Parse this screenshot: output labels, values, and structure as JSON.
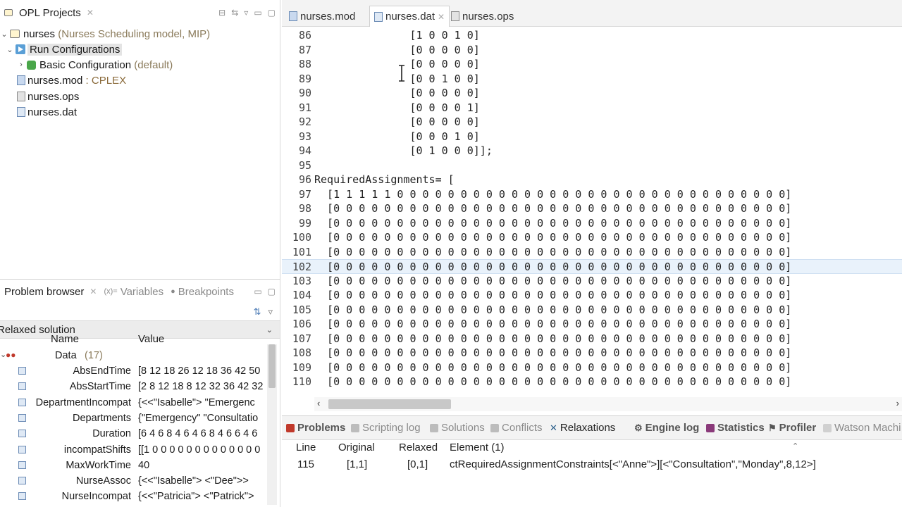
{
  "explorer": {
    "title": "OPL Projects",
    "tree": {
      "project_name": "nurses",
      "project_desc": "(Nurses Scheduling model, MIP)",
      "run_configs": "Run Configurations",
      "basic_config": "Basic Configuration",
      "basic_config_suffix": "(default)",
      "mod_file": "nurses.mod",
      "mod_suffix": ": CPLEX",
      "ops_file": "nurses.ops",
      "dat_file": "nurses.dat"
    }
  },
  "problem_view": {
    "tabs": [
      "Problem browser",
      "Variables",
      "Breakpoints"
    ],
    "section": "Relaxed solution",
    "col_name": "Name",
    "col_value": "Value",
    "group_label": "Data",
    "group_count": "(17)",
    "rows": [
      {
        "name": "AbsEndTime",
        "value": "[8 12 18 26 12 18 36 42 50"
      },
      {
        "name": "AbsStartTime",
        "value": "[2 8 12 18 8 12 32 36 42 32"
      },
      {
        "name": "DepartmentIncompat",
        "value": "{<<\"Isabelle\"> \"Emergenc"
      },
      {
        "name": "Departments",
        "value": "{\"Emergency\" \"Consultatio"
      },
      {
        "name": "Duration",
        "value": "[6 4 6 8 4 6 4 6 8 4 6 6 4 6"
      },
      {
        "name": "incompatShifts",
        "value": "[[1 0 0 0 0 0 0 0 0 0 0 0 0 0"
      },
      {
        "name": "MaxWorkTime",
        "value": "40"
      },
      {
        "name": "NurseAssoc",
        "value": "{<<\"Isabelle\"> <\"Dee\">>"
      },
      {
        "name": "NurseIncompat",
        "value": "{<<\"Patricia\"> <\"Patrick\">"
      }
    ]
  },
  "editor": {
    "tabs": [
      "nurses.mod",
      "nurses.dat",
      "nurses.ops"
    ],
    "active_tab": "nurses.dat",
    "lines": [
      {
        "n": "86",
        "code": "               [1 0 0 1 0]"
      },
      {
        "n": "87",
        "code": "               [0 0 0 0 0]"
      },
      {
        "n": "88",
        "code": "               [0 0 0 0 0]"
      },
      {
        "n": "89",
        "code": "               [0 0 1 0 0]"
      },
      {
        "n": "90",
        "code": "               [0 0 0 0 0]"
      },
      {
        "n": "91",
        "code": "               [0 0 0 0 1]"
      },
      {
        "n": "92",
        "code": "               [0 0 0 0 0]"
      },
      {
        "n": "93",
        "code": "               [0 0 0 1 0]"
      },
      {
        "n": "94",
        "code": "               [0 1 0 0 0]];"
      },
      {
        "n": "95",
        "code": ""
      },
      {
        "n": "96",
        "code": "RequiredAssignments= ["
      },
      {
        "n": "97",
        "code": "  [1 1 1 1 1 0 0 0 0 0 0 0 0 0 0 0 0 0 0 0 0 0 0 0 0 0 0 0 0 0 0 0 0 0 0 0]"
      },
      {
        "n": "98",
        "code": "  [0 0 0 0 0 0 0 0 0 0 0 0 0 0 0 0 0 0 0 0 0 0 0 0 0 0 0 0 0 0 0 0 0 0 0 0]"
      },
      {
        "n": "99",
        "code": "  [0 0 0 0 0 0 0 0 0 0 0 0 0 0 0 0 0 0 0 0 0 0 0 0 0 0 0 0 0 0 0 0 0 0 0 0]"
      },
      {
        "n": "100",
        "code": "  [0 0 0 0 0 0 0 0 0 0 0 0 0 0 0 0 0 0 0 0 0 0 0 0 0 0 0 0 0 0 0 0 0 0 0 0]"
      },
      {
        "n": "101",
        "code": "  [0 0 0 0 0 0 0 0 0 0 0 0 0 0 0 0 0 0 0 0 0 0 0 0 0 0 0 0 0 0 0 0 0 0 0 0]"
      },
      {
        "n": "102",
        "code": "  [0 0 0 0 0 0 0 0 0 0 0 0 0 0 0 0 0 0 0 0 0 0 0 0 0 0 0 0 0 0 0 0 0 0 0 0]"
      },
      {
        "n": "103",
        "code": "  [0 0 0 0 0 0 0 0 0 0 0 0 0 0 0 0 0 0 0 0 0 0 0 0 0 0 0 0 0 0 0 0 0 0 0 0]"
      },
      {
        "n": "104",
        "code": "  [0 0 0 0 0 0 0 0 0 0 0 0 0 0 0 0 0 0 0 0 0 0 0 0 0 0 0 0 0 0 0 0 0 0 0 0]"
      },
      {
        "n": "105",
        "code": "  [0 0 0 0 0 0 0 0 0 0 0 0 0 0 0 0 0 0 0 0 0 0 0 0 0 0 0 0 0 0 0 0 0 0 0 0]"
      },
      {
        "n": "106",
        "code": "  [0 0 0 0 0 0 0 0 0 0 0 0 0 0 0 0 0 0 0 0 0 0 0 0 0 0 0 0 0 0 0 0 0 0 0 0]"
      },
      {
        "n": "107",
        "code": "  [0 0 0 0 0 0 0 0 0 0 0 0 0 0 0 0 0 0 0 0 0 0 0 0 0 0 0 0 0 0 0 0 0 0 0 0]"
      },
      {
        "n": "108",
        "code": "  [0 0 0 0 0 0 0 0 0 0 0 0 0 0 0 0 0 0 0 0 0 0 0 0 0 0 0 0 0 0 0 0 0 0 0 0]"
      },
      {
        "n": "109",
        "code": "  [0 0 0 0 0 0 0 0 0 0 0 0 0 0 0 0 0 0 0 0 0 0 0 0 0 0 0 0 0 0 0 0 0 0 0 0]"
      },
      {
        "n": "110",
        "code": "  [0 0 0 0 0 0 0 0 0 0 0 0 0 0 0 0 0 0 0 0 0 0 0 0 0 0 0 0 0 0 0 0 0 0 0 0]"
      }
    ],
    "current_line": "102"
  },
  "bottom_views": {
    "tabs": [
      "Problems",
      "Scripting log",
      "Solutions",
      "Conflicts",
      "Relaxations",
      "Engine log",
      "Statistics",
      "Profiler",
      "Watson Machi"
    ],
    "active_tab": "Relaxations",
    "relax_table": {
      "headers": [
        "Line",
        "Original",
        "Relaxed",
        "Element (1)"
      ],
      "rows": [
        [
          "115",
          "[1,1]",
          "[0,1]",
          "ctRequiredAssignmentConstraints[<\"Anne\">][<\"Consultation\",\"Monday\",8,12>]"
        ]
      ]
    }
  },
  "colors": {
    "accent": "#2b5f8a",
    "current_line": "#e9f2fb",
    "section_bg": "#ececec"
  }
}
